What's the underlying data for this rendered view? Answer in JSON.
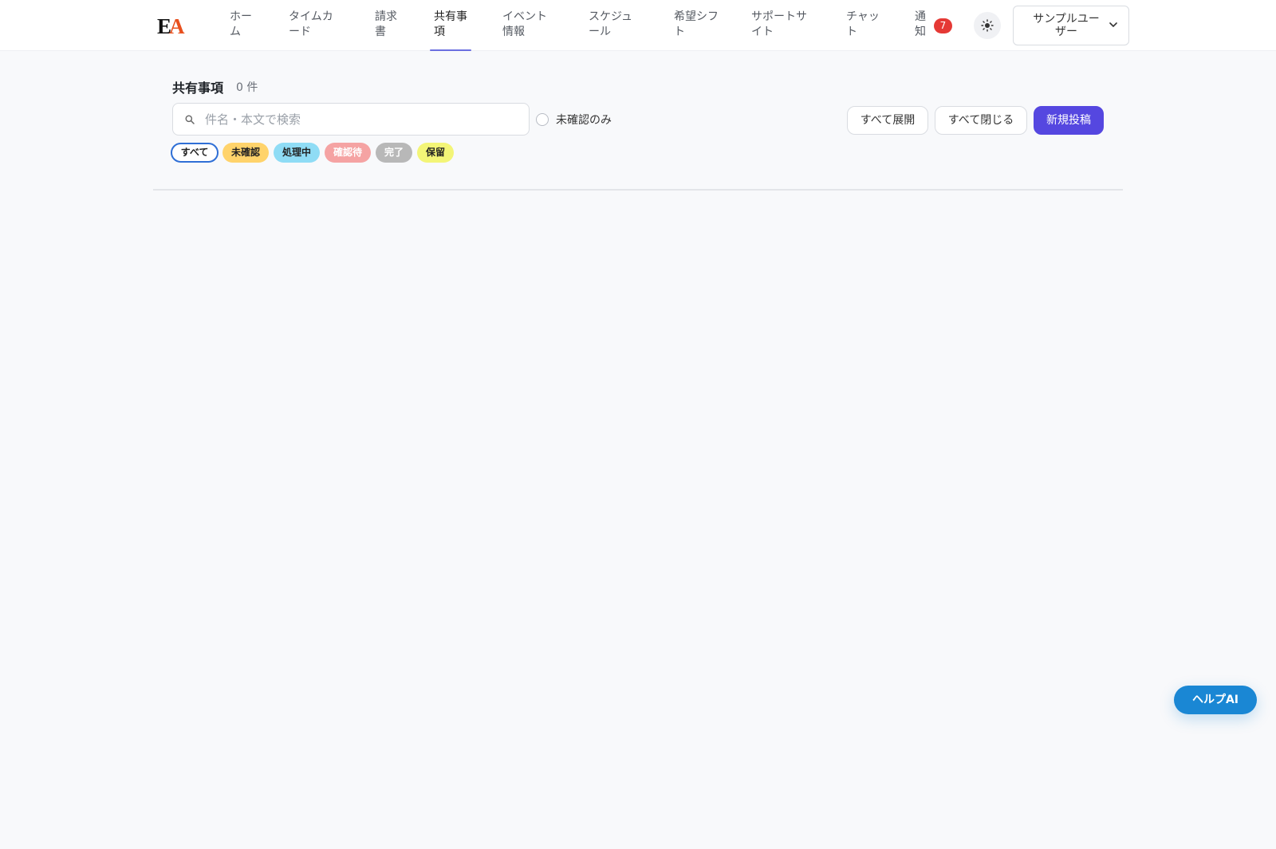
{
  "header": {
    "logo_text": "EA",
    "nav": [
      {
        "l1": "ホー",
        "l2": "ム"
      },
      {
        "l1": "タイムカ",
        "l2": "ード"
      },
      {
        "l1": "請求",
        "l2": "書"
      },
      {
        "l1": "共有事",
        "l2": "項"
      },
      {
        "l1": "イベント",
        "l2": "情報"
      },
      {
        "l1": "スケジュ",
        "l2": "ール"
      },
      {
        "l1": "希望シフ",
        "l2": "ト"
      },
      {
        "l1": "サポートサ",
        "l2": "イト"
      },
      {
        "l1": "チャッ",
        "l2": "ト"
      },
      {
        "l1": "通",
        "l2": "知"
      }
    ],
    "active_index": 3,
    "notification_count": "7",
    "user_name_line1": "サンプルユー",
    "user_name_line2": "ザー",
    "accent_color": "#6b6fe0"
  },
  "main": {
    "title": "共有事項",
    "count": "0 件",
    "search_placeholder": "件名・本文で検索",
    "search_value": "",
    "unconfirmed_only_label": "未確認のみ",
    "expand_all_label": "すべて展開",
    "collapse_all_label": "すべて閉じる",
    "new_post_label": "新規投稿",
    "filters": [
      {
        "label": "すべて",
        "bg": "#ffffff",
        "color": "#222222"
      },
      {
        "label": "未確認",
        "bg": "#ffd36b",
        "color": "#222222"
      },
      {
        "label": "処理中",
        "bg": "#8fdcf5",
        "color": "#222222"
      },
      {
        "label": "確認待",
        "bg": "#f5a3a3",
        "color": "#ffffff"
      },
      {
        "label": "完了",
        "bg": "#b8b8b8",
        "color": "#ffffff"
      },
      {
        "label": "保留",
        "bg": "#f3f577",
        "color": "#222222"
      }
    ]
  },
  "help_button_label": "ヘルプAI",
  "colors": {
    "primary": "#5547e0",
    "help": "#1a87d4",
    "badge": "#e53935"
  }
}
